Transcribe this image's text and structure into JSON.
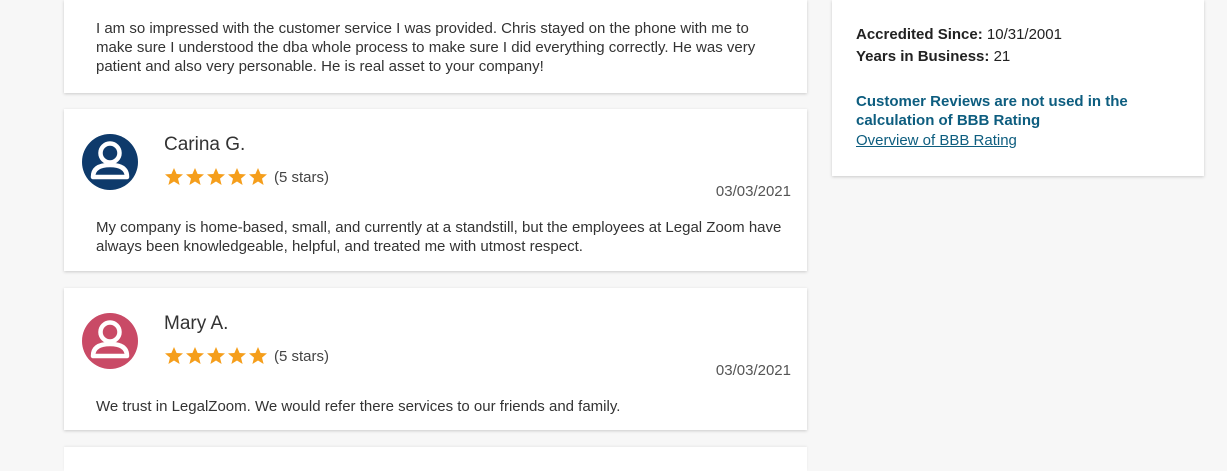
{
  "colors": {
    "star": "#f59e1b",
    "avatar_blue": "#0e3a6b",
    "avatar_red": "#c94a66",
    "link": "#0d5d7f"
  },
  "reviews": [
    {
      "text": "I am so impressed with the customer service I was provided. Chris stayed on the phone with me to make sure I understood the dba whole process to make sure I did everything correctly. He was very patient and also very personable. He is real asset to your company!"
    },
    {
      "name": "Carina G.",
      "rating": 5,
      "stars_label": "(5 stars)",
      "date": "03/03/2021",
      "avatar_icon": "user-avatar-icon",
      "text": "My company is home-based, small, and currently at a standstill, but the employees at Legal Zoom have always been knowledgeable, helpful, and treated me with utmost respect."
    },
    {
      "name": "Mary A.",
      "rating": 5,
      "stars_label": "(5 stars)",
      "date": "03/03/2021",
      "avatar_icon": "user-avatar-icon",
      "text": "We trust in LegalZoom. We would refer there services to our friends and family."
    }
  ],
  "sidebar": {
    "accredited_label": "Accredited Since:",
    "accredited_value": "10/31/2001",
    "years_label": "Years in Business:",
    "years_value": "21",
    "note": "Customer Reviews are not used in the calculation of BBB Rating",
    "link": "Overview of BBB Rating"
  }
}
